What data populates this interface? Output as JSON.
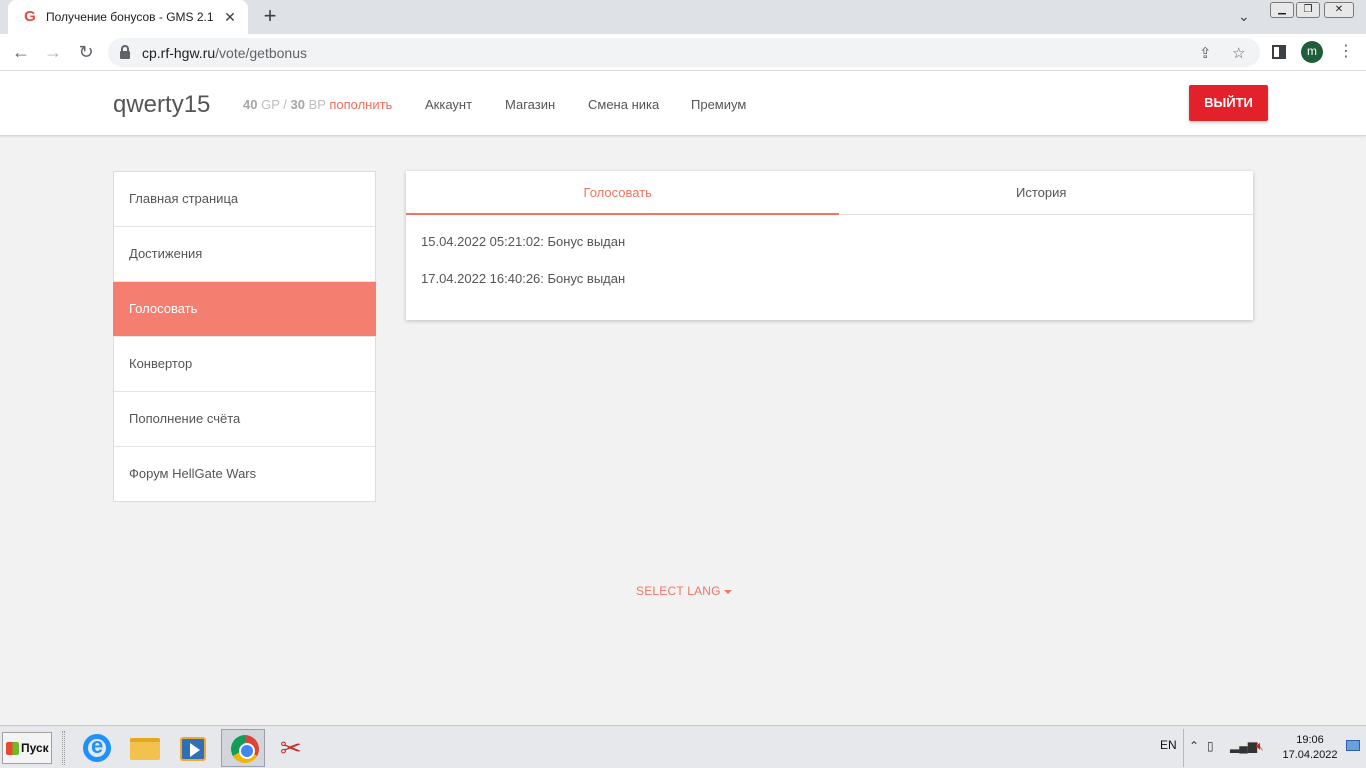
{
  "browser": {
    "tab_title": "Получение бонусов - GMS 2.1",
    "favicon": "G",
    "url_domain": "cp.rf-hgw.ru",
    "url_path": "/vote/getbonus",
    "profile_initial": "m"
  },
  "header": {
    "username": "qwerty15",
    "gp_value": "40",
    "gp_unit": "GP",
    "bp_value": "30",
    "bp_unit": "BP",
    "topup_label": "пополнить",
    "nav": [
      "Аккаунт",
      "Магазин",
      "Смена ника",
      "Премиум"
    ],
    "logout_label": "ВЫЙТИ"
  },
  "sidebar": {
    "items": [
      {
        "label": "Главная страница"
      },
      {
        "label": "Достижения"
      },
      {
        "label": "Голосовать",
        "active": true
      },
      {
        "label": "Конвертор"
      },
      {
        "label": "Пополнение счёта"
      },
      {
        "label": "Форум HellGate Wars"
      }
    ]
  },
  "main": {
    "tabs": [
      "Голосовать",
      "История"
    ],
    "active_tab": "Голосовать",
    "history": [
      "15.04.2022 05:21:02: Бонус выдан",
      "17.04.2022 16:40:26: Бонус выдан"
    ]
  },
  "footer": {
    "select_lang": "SELECT LANG"
  },
  "taskbar": {
    "start_label": "Пуск",
    "language": "EN",
    "time": "19:06",
    "date": "17.04.2022"
  },
  "colors": {
    "accent": "#f07563",
    "sidebar_active": "#f47f70",
    "logout": "#e3212a"
  }
}
